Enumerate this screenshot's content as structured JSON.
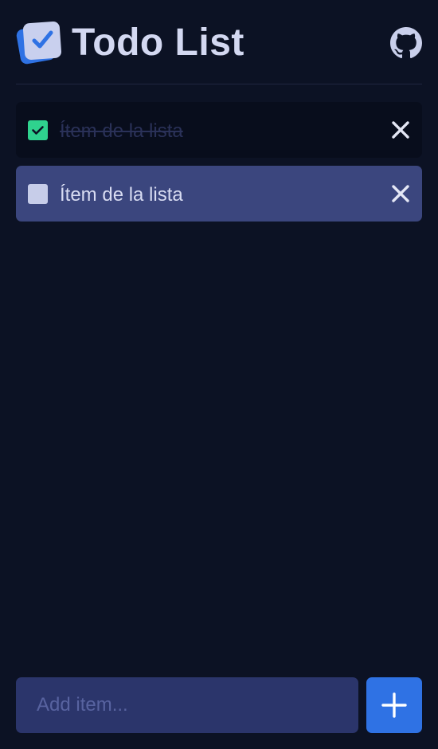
{
  "header": {
    "title": "Todo List",
    "logo_icon": "checkbox-logo-icon",
    "github_icon": "github-icon"
  },
  "items": [
    {
      "label": "Ítem de la lista",
      "completed": true
    },
    {
      "label": "Ítem de la lista",
      "completed": false
    }
  ],
  "footer": {
    "input_placeholder": "Add item...",
    "input_value": "",
    "add_icon": "plus-icon"
  },
  "colors": {
    "background": "#0c1224",
    "item_done_bg": "#080d1c",
    "item_active_bg": "#3b467e",
    "checkbox_done": "#2fd28e",
    "input_bg": "#2b356b",
    "accent": "#2f72e4"
  }
}
